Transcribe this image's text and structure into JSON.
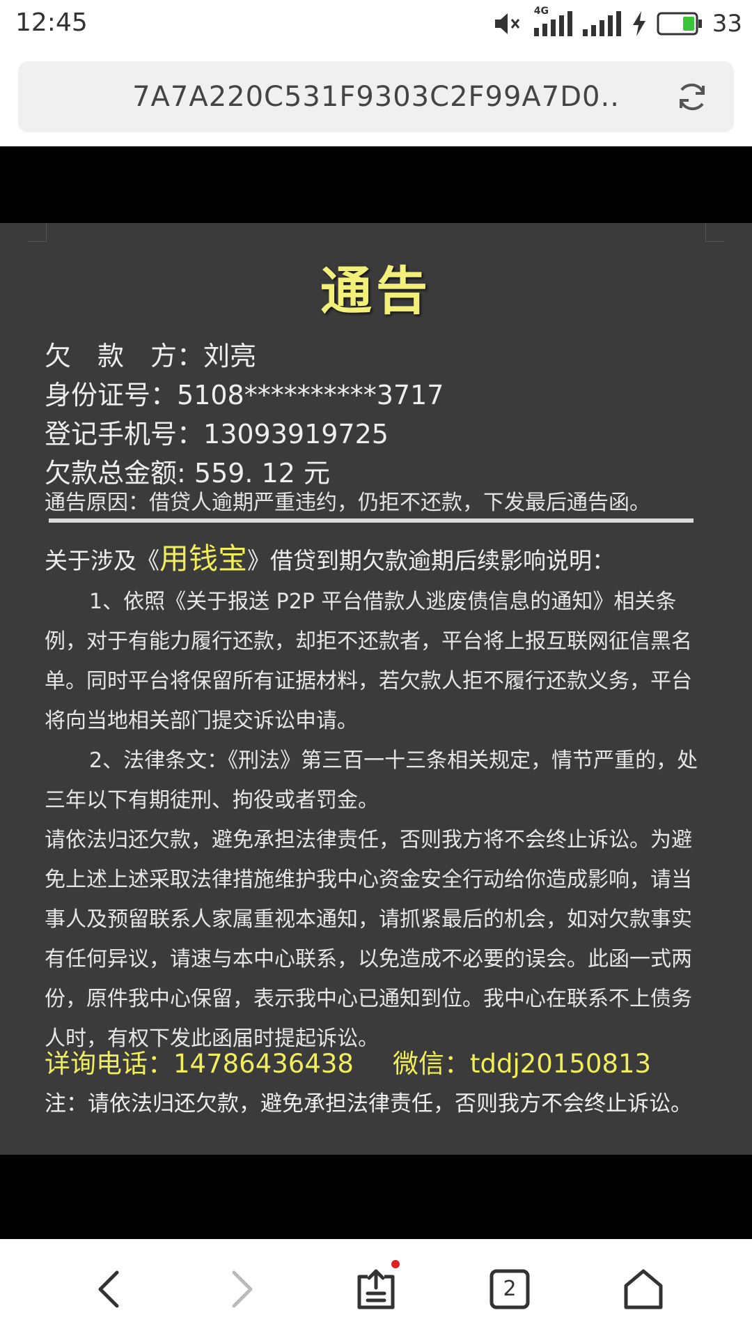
{
  "status_bar": {
    "time": "12:45",
    "network_label": "4G",
    "battery_level": "33",
    "icons": [
      "mute-icon",
      "signal-4g-icon",
      "signal-icon",
      "charging-icon",
      "battery-icon"
    ]
  },
  "address_bar": {
    "url": "7A7A220C531F9303C2F99A7D0..",
    "icons": [
      "refresh-icon"
    ]
  },
  "notice": {
    "title": "通告",
    "debtor_label": "欠　款　方：",
    "debtor_value": "刘亮",
    "id_label": "身份证号：",
    "id_value": "5108**********3717",
    "phone_label": "登记手机号：",
    "phone_value": "13093919725",
    "amount_label": "欠款总金额:",
    "amount_value": " 559. 12 元",
    "reason": "通告原因：借贷人逾期严重违约，仍拒不还款，下发最后通告函。",
    "subheading_prefix": "关于涉及《",
    "app_name": "用钱宝",
    "subheading_suffix": "》借贷到期欠款逾期后续影响说明：",
    "clause_1": "1、依照《关于报送 P2P 平台借款人逃废债信息的通知》相关条例，对于有能力履行还款，却拒不还款者，平台将上报互联网征信黑名单。同时平台将保留所有证据材料，若欠款人拒不履行还款义务，平台将向当地相关部门提交诉讼申请。",
    "clause_2": "2、法律条文：《刑法》第三百一十三条相关规定，情节严重的，处三年以下有期徒刑、拘役或者罚金。",
    "body": "请依法归还欠款，避免承担法律责任，否则我方将不会终止诉讼。为避免上述上述采取法律措施维护我中心资金安全行动给你造成影响，请当事人及预留联系人家属重视本通知，请抓紧最后的机会，如对欠款事实有任何异议，请速与本中心联系，以免造成不必要的误会。此函一式两份，原件我中心保留，表示我中心已通知到位。我中心在联系不上债务人时，有权下发此函届时提起诉讼。",
    "contact_phone": "详询电话：14786436438",
    "contact_wechat": "微信：tddj20150813",
    "note": "注：请依法归还欠款，避免承担法律责任，否则我方不会终止诉讼。"
  },
  "bottom_nav": {
    "tab_count": "2",
    "icons": [
      "back-icon",
      "forward-icon",
      "share-icon",
      "tabs-icon",
      "home-icon"
    ]
  },
  "colors": {
    "panel_bg": "#3b3b3b",
    "highlight_yellow": "#f0ee5a",
    "title_yellow": "#f3f07a",
    "notification_dot": "#e02020"
  }
}
